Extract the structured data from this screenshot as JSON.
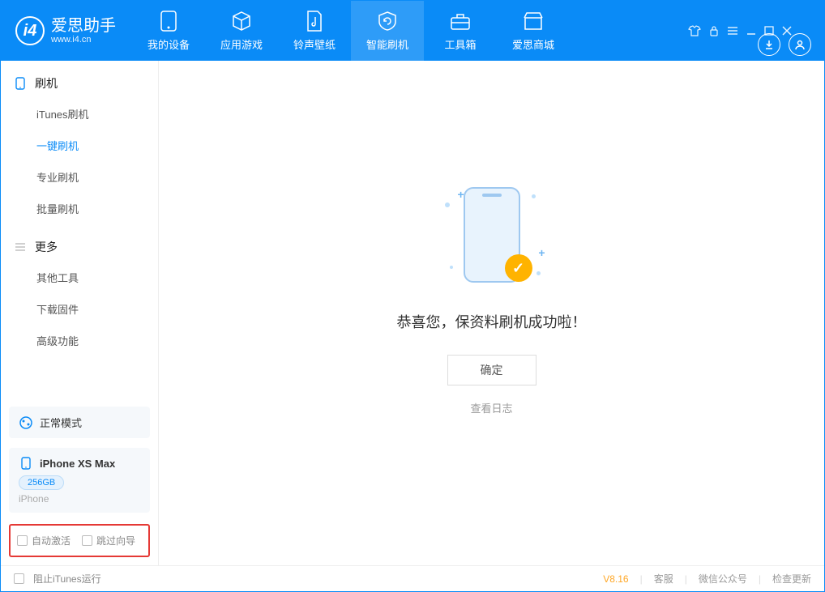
{
  "app": {
    "name": "爱思助手",
    "url": "www.i4.cn"
  },
  "tabs": [
    {
      "label": "我的设备"
    },
    {
      "label": "应用游戏"
    },
    {
      "label": "铃声壁纸"
    },
    {
      "label": "智能刷机"
    },
    {
      "label": "工具箱"
    },
    {
      "label": "爱思商城"
    }
  ],
  "sidebar": {
    "section1": {
      "title": "刷机",
      "items": [
        "iTunes刷机",
        "一键刷机",
        "专业刷机",
        "批量刷机"
      ]
    },
    "section2": {
      "title": "更多",
      "items": [
        "其他工具",
        "下载固件",
        "高级功能"
      ]
    },
    "mode": "正常模式",
    "device": {
      "name": "iPhone XS Max",
      "capacity": "256GB",
      "type": "iPhone"
    },
    "checkboxes": {
      "auto_activate": "自动激活",
      "skip_guide": "跳过向导"
    }
  },
  "main": {
    "success_message": "恭喜您，保资料刷机成功啦！",
    "ok_button": "确定",
    "view_log": "查看日志"
  },
  "status": {
    "block_itunes": "阻止iTunes运行",
    "version": "V8.16",
    "links": [
      "客服",
      "微信公众号",
      "检查更新"
    ]
  }
}
